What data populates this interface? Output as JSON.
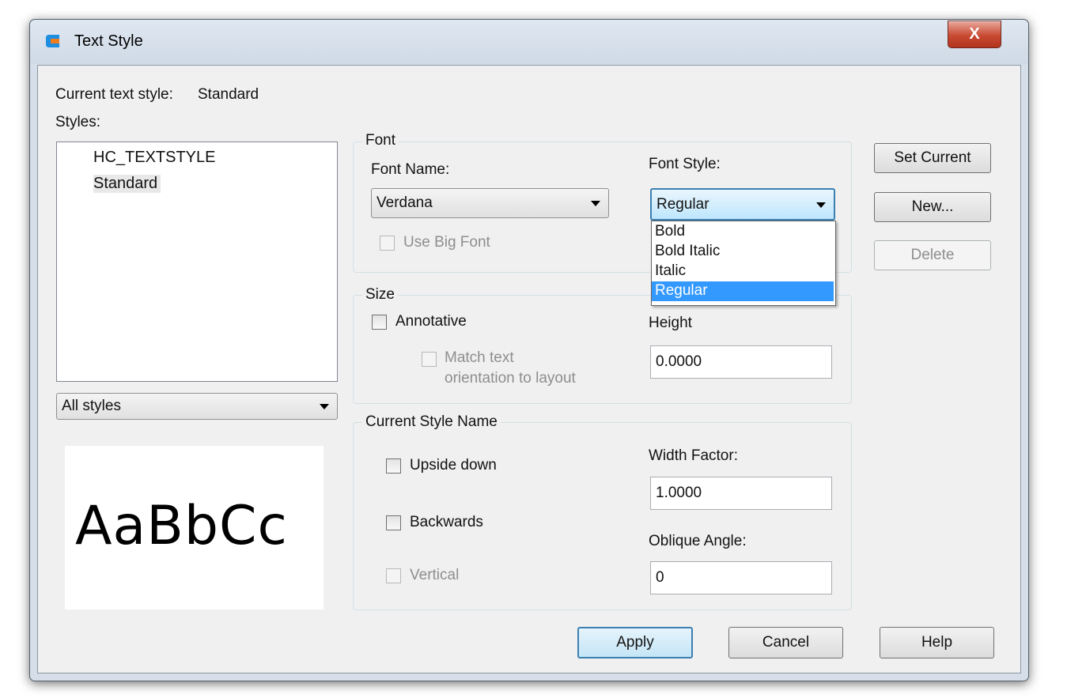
{
  "window": {
    "title": "Text Style",
    "close_glyph": "X",
    "app_icon": "gstarcad-logo-icon",
    "accent": "#3399ff"
  },
  "current_style": {
    "label": "Current text style:",
    "value": "Standard"
  },
  "styles": {
    "label": "Styles:",
    "items": [
      {
        "label": "HC_TEXTSTYLE"
      },
      {
        "label": "Standard"
      }
    ],
    "filter": "All styles",
    "preview_text": "AaBbCc"
  },
  "font": {
    "group_title": "Font",
    "name_label": "Font Name:",
    "name_value": "Verdana",
    "style_label": "Font Style:",
    "style_value": "Regular",
    "style_options": [
      {
        "label": "Bold"
      },
      {
        "label": "Bold Italic"
      },
      {
        "label": "Italic"
      },
      {
        "label": "Regular"
      }
    ],
    "big_font_label": "Use Big Font"
  },
  "size": {
    "group_title": "Size",
    "annotative_label": "Annotative",
    "match_label_1": "Match text",
    "match_label_2": "orientation to layout",
    "height_label": "Height",
    "height_value": "0.0000"
  },
  "effects": {
    "group_title": "Current Style Name",
    "upside_down_label": "Upside down",
    "backwards_label": "Backwards",
    "vertical_label": "Vertical",
    "width_factor_label": "Width Factor:",
    "width_factor_value": "1.0000",
    "oblique_label": "Oblique Angle:",
    "oblique_value": "0"
  },
  "side_buttons": {
    "set_current": "Set Current",
    "new": "New...",
    "delete": "Delete"
  },
  "footer": {
    "apply": "Apply",
    "cancel": "Cancel",
    "help": "Help"
  }
}
